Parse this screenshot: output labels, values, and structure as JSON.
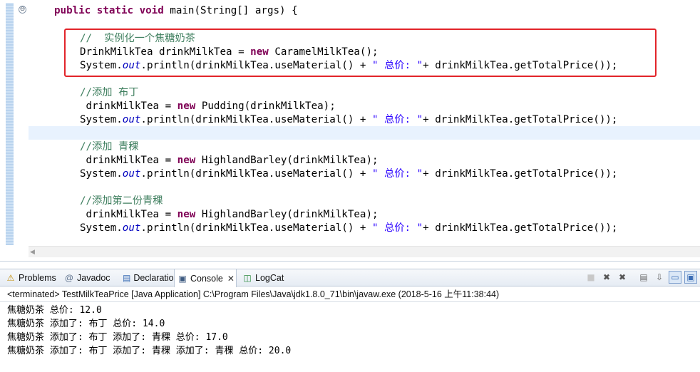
{
  "editor": {
    "lines": [
      {
        "parts": [
          {
            "t": "public static void ",
            "c": "kw"
          },
          {
            "t": "main(String[] args) {",
            "c": ""
          }
        ]
      },
      {
        "parts": [
          {
            "t": "//  ",
            "c": "cm"
          },
          {
            "t": "实例化一个焦糖奶茶",
            "c": "cm zh"
          }
        ]
      },
      {
        "parts": [
          {
            "t": "DrinkMilkTea drinkMilkTea = ",
            "c": ""
          },
          {
            "t": "new",
            "c": "kw"
          },
          {
            "t": " CaramelMilkTea();",
            "c": ""
          }
        ]
      },
      {
        "parts": [
          {
            "t": "System.",
            "c": ""
          },
          {
            "t": "out",
            "c": "it"
          },
          {
            "t": ".println(drinkMilkTea.useMaterial() + ",
            "c": ""
          },
          {
            "t": "\" ",
            "c": "str"
          },
          {
            "t": "总价: ",
            "c": "str zh"
          },
          {
            "t": "\"",
            "c": "str"
          },
          {
            "t": "+ drinkMilkTea.getTotalPrice());",
            "c": ""
          }
        ]
      },
      {
        "parts": [
          {
            "t": "//添加 ",
            "c": "cm"
          },
          {
            "t": "布丁",
            "c": "cm zh"
          }
        ]
      },
      {
        "parts": [
          {
            "t": " drinkMilkTea = ",
            "c": ""
          },
          {
            "t": "new",
            "c": "kw"
          },
          {
            "t": " Pudding(drinkMilkTea);",
            "c": ""
          }
        ]
      },
      {
        "parts": [
          {
            "t": "System.",
            "c": ""
          },
          {
            "t": "out",
            "c": "it"
          },
          {
            "t": ".println(drinkMilkTea.useMaterial() + ",
            "c": ""
          },
          {
            "t": "\" ",
            "c": "str"
          },
          {
            "t": "总价: ",
            "c": "str zh"
          },
          {
            "t": "\"",
            "c": "str"
          },
          {
            "t": "+ drinkMilkTea.getTotalPrice());",
            "c": ""
          }
        ]
      },
      {
        "parts": []
      },
      {
        "parts": [
          {
            "t": "//添加 ",
            "c": "cm"
          },
          {
            "t": "青稞",
            "c": "cm zh"
          }
        ]
      },
      {
        "parts": [
          {
            "t": " drinkMilkTea = ",
            "c": ""
          },
          {
            "t": "new",
            "c": "kw"
          },
          {
            "t": " HighlandBarley(drinkMilkTea);",
            "c": ""
          }
        ]
      },
      {
        "parts": [
          {
            "t": "System.",
            "c": ""
          },
          {
            "t": "out",
            "c": "it"
          },
          {
            "t": ".println(drinkMilkTea.useMaterial() + ",
            "c": ""
          },
          {
            "t": "\" ",
            "c": "str"
          },
          {
            "t": "总价: ",
            "c": "str zh"
          },
          {
            "t": "\"",
            "c": "str"
          },
          {
            "t": "+ drinkMilkTea.getTotalPrice());",
            "c": ""
          }
        ]
      },
      {
        "parts": [
          {
            "t": "//",
            "c": "cm"
          },
          {
            "t": "添加第二份青稞",
            "c": "cm zh"
          }
        ]
      },
      {
        "parts": [
          {
            "t": " drinkMilkTea = ",
            "c": ""
          },
          {
            "t": "new",
            "c": "kw"
          },
          {
            "t": " HighlandBarley(drinkMilkTea);",
            "c": ""
          }
        ]
      },
      {
        "parts": [
          {
            "t": "System.",
            "c": ""
          },
          {
            "t": "out",
            "c": "it"
          },
          {
            "t": ".println(drinkMilkTea.useMaterial() + ",
            "c": ""
          },
          {
            "t": "\" ",
            "c": "str"
          },
          {
            "t": "总价: ",
            "c": "str zh"
          },
          {
            "t": "\"",
            "c": "str"
          },
          {
            "t": "+ drinkMilkTea.getTotalPrice());",
            "c": ""
          }
        ]
      }
    ],
    "fold_glyph": "⊖",
    "scroll_left_glyph": "◀"
  },
  "panel": {
    "tabs": [
      {
        "label": "Problems",
        "icon": "problems-icon",
        "glyph": "⚠"
      },
      {
        "label": "Javadoc",
        "icon": "javadoc-icon",
        "glyph": "@"
      },
      {
        "label": "Declaration",
        "icon": "declaration-icon",
        "glyph": "▤"
      },
      {
        "label": "Console",
        "icon": "console-icon",
        "glyph": "▣",
        "active": true,
        "close": "✕"
      },
      {
        "label": "LogCat",
        "icon": "logcat-icon",
        "glyph": "◫"
      }
    ],
    "toolbar": [
      {
        "name": "terminate-icon",
        "glyph": "■"
      },
      {
        "name": "remove-launch-icon",
        "glyph": "✖"
      },
      {
        "name": "remove-all-icon",
        "glyph": "✖"
      },
      {
        "name": "clear-console-icon",
        "glyph": "▤"
      },
      {
        "name": "scroll-lock-icon",
        "glyph": "⇩"
      },
      {
        "name": "pin-console-icon",
        "glyph": "▭"
      },
      {
        "name": "display-console-icon",
        "glyph": "▣"
      }
    ],
    "status_text": "<terminated> TestMilkTeaPrice [Java Application] C:\\Program Files\\Java\\jdk1.8.0_71\\bin\\javaw.exe (2018-5-16 上午11:38:44)",
    "output": [
      "焦糖奶茶 总价: 12.0",
      "焦糖奶茶 添加了: 布丁 总价: 14.0",
      "焦糖奶茶 添加了: 布丁 添加了: 青稞 总价: 17.0",
      "焦糖奶茶 添加了: 布丁 添加了: 青稞 添加了: 青稞 总价: 20.0"
    ]
  },
  "colors": {
    "annotation_box": "#e2242a",
    "keyword": "#7f0055",
    "comment": "#3f7f5f",
    "string": "#2a00ff",
    "static_field": "#0000c0"
  }
}
